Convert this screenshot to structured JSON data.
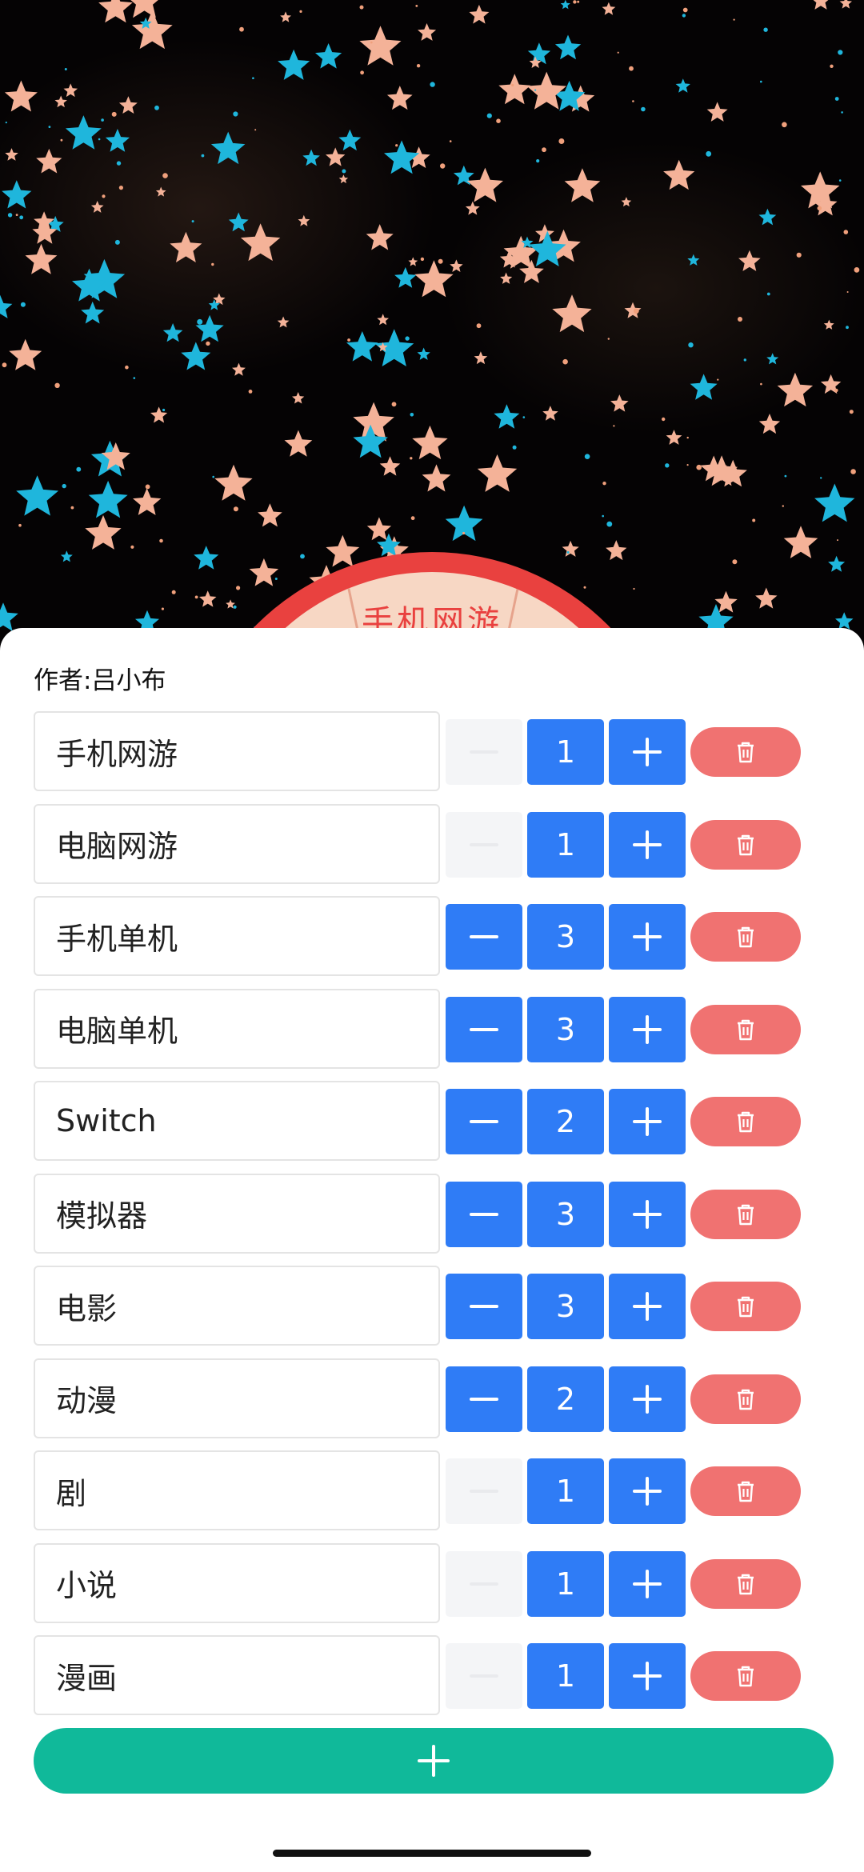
{
  "author_label": "作者:吕小布",
  "wheel": {
    "top_segment_label": "手机网游"
  },
  "items": [
    {
      "name": "手机网游",
      "count": "1",
      "minus_enabled": false
    },
    {
      "name": "电脑网游",
      "count": "1",
      "minus_enabled": false
    },
    {
      "name": "手机单机",
      "count": "3",
      "minus_enabled": true
    },
    {
      "name": "电脑单机",
      "count": "3",
      "minus_enabled": true
    },
    {
      "name": "Switch",
      "count": "2",
      "minus_enabled": true
    },
    {
      "name": "模拟器",
      "count": "3",
      "minus_enabled": true
    },
    {
      "name": "电影",
      "count": "3",
      "minus_enabled": true
    },
    {
      "name": "动漫",
      "count": "2",
      "minus_enabled": true
    },
    {
      "name": "剧",
      "count": "1",
      "minus_enabled": false
    },
    {
      "name": "小说",
      "count": "1",
      "minus_enabled": false
    },
    {
      "name": "漫画",
      "count": "1",
      "minus_enabled": false
    }
  ],
  "icons": {
    "minus": "minus-icon",
    "plus": "plus-icon",
    "delete": "trash-icon",
    "add": "plus-icon"
  },
  "colors": {
    "stepper_blue": "#2f7cf6",
    "delete_red": "#f07271",
    "add_green": "#10b99a",
    "wheel_red": "#e9413f"
  }
}
